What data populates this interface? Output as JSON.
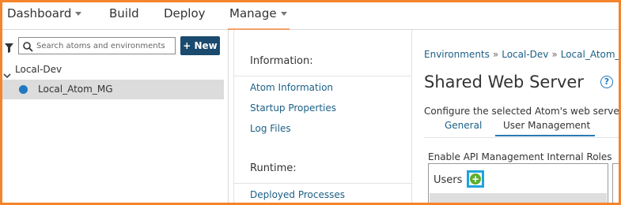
{
  "topnav": {
    "items": [
      {
        "label": "Dashboard",
        "dropdown": true
      },
      {
        "label": "Build",
        "dropdown": false
      },
      {
        "label": "Deploy",
        "dropdown": false
      },
      {
        "label": "Manage",
        "dropdown": true,
        "active": true
      }
    ]
  },
  "sidebar": {
    "search": {
      "placeholder": "Search atoms and environments",
      "value": ""
    },
    "new_button": "+ New",
    "tree": {
      "group": "Local-Dev",
      "items": [
        {
          "label": "Local_Atom_MG",
          "status_color": "#1f78c1",
          "selected": true
        }
      ]
    }
  },
  "middle": {
    "information_heading": "Information:",
    "information_links": [
      "Atom Information",
      "Startup Properties",
      "Log Files"
    ],
    "runtime_heading": "Runtime:",
    "runtime_links": [
      "Deployed Processes"
    ]
  },
  "content": {
    "breadcrumb": [
      "Environments",
      "Local-Dev",
      "Local_Atom_MG"
    ],
    "breadcrumb_separator": "»",
    "title": "Shared Web Server",
    "help_icon": "?",
    "description": "Configure the selected Atom's web server",
    "tabs": [
      {
        "label": "General",
        "active": false
      },
      {
        "label": "User Management",
        "active": true
      }
    ],
    "api_management_label": "Enable API Management Internal Roles",
    "users_label": "Users",
    "add_user_icon": "+"
  },
  "colors": {
    "accent_border": "#f5842b",
    "primary_button": "#1a4a6e",
    "link": "#1b5f86",
    "add_icon": "#5cae2e",
    "highlight_box": "#1fa3dc"
  }
}
